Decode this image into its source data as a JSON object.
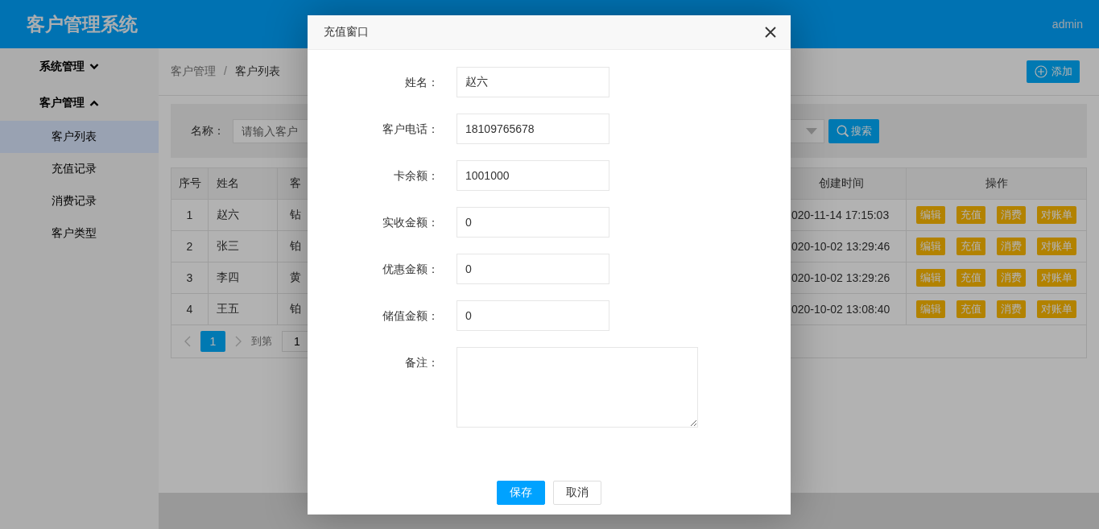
{
  "header": {
    "title": "客户管理系统",
    "user": "admin"
  },
  "sidebar": {
    "groups": [
      {
        "label": "系统管理",
        "expanded": false
      },
      {
        "label": "客户管理",
        "expanded": true,
        "children": [
          {
            "label": "客户列表",
            "selected": true
          },
          {
            "label": "充值记录",
            "selected": false
          },
          {
            "label": "消费记录",
            "selected": false
          },
          {
            "label": "客户类型",
            "selected": false
          }
        ]
      }
    ]
  },
  "breadcrumb": {
    "items": [
      "客户管理",
      "客户列表"
    ],
    "separators": [
      "/"
    ]
  },
  "add_button": "添加",
  "search": {
    "label": "名称：",
    "placeholder": "请输入客户",
    "button": "搜索"
  },
  "table": {
    "columns": [
      "序号",
      "姓名",
      "客",
      "创建时间",
      "操作"
    ],
    "rows": [
      {
        "index": "1",
        "name": "赵六",
        "column_3": "钻",
        "created": "020-11-14 17:15:03",
        "actions": [
          "编辑",
          "充值",
          "消费",
          "对账单"
        ]
      },
      {
        "index": "2",
        "name": "张三",
        "column_3": "铂",
        "created": "020-10-02 13:29:46",
        "actions": [
          "编辑",
          "充值",
          "消费",
          "对账单"
        ]
      },
      {
        "index": "3",
        "name": "李四",
        "column_3": "黄",
        "created": "020-10-02 13:29:26",
        "actions": [
          "编辑",
          "充值",
          "消费",
          "对账单"
        ]
      },
      {
        "index": "4",
        "name": "王五",
        "column_3": "铂",
        "created": "020-10-02 13:08:40",
        "actions": [
          "编辑",
          "充值",
          "消费",
          "对账单"
        ]
      }
    ]
  },
  "pagination": {
    "pages": [
      {
        "label": "1",
        "selected": true
      }
    ],
    "goto_label": "到第",
    "goto_value": "1"
  },
  "dialog": {
    "title": "充值窗口",
    "fields": [
      {
        "label": "姓名：",
        "value": "赵六",
        "kind": "input"
      },
      {
        "label": "客户电话：",
        "value": "18109765678",
        "kind": "input"
      },
      {
        "label": "卡余额：",
        "value": "1001000",
        "kind": "input"
      },
      {
        "label": "实收金额：",
        "value": "0",
        "kind": "input"
      },
      {
        "label": "优惠金额：",
        "value": "0",
        "kind": "input"
      },
      {
        "label": "储值金额：",
        "value": "0",
        "kind": "input"
      },
      {
        "label": "备注：",
        "kind": "textarea"
      }
    ],
    "buttons": [
      {
        "label": "保存",
        "kind": "primary"
      },
      {
        "label": "取消",
        "kind": "default"
      }
    ]
  }
}
